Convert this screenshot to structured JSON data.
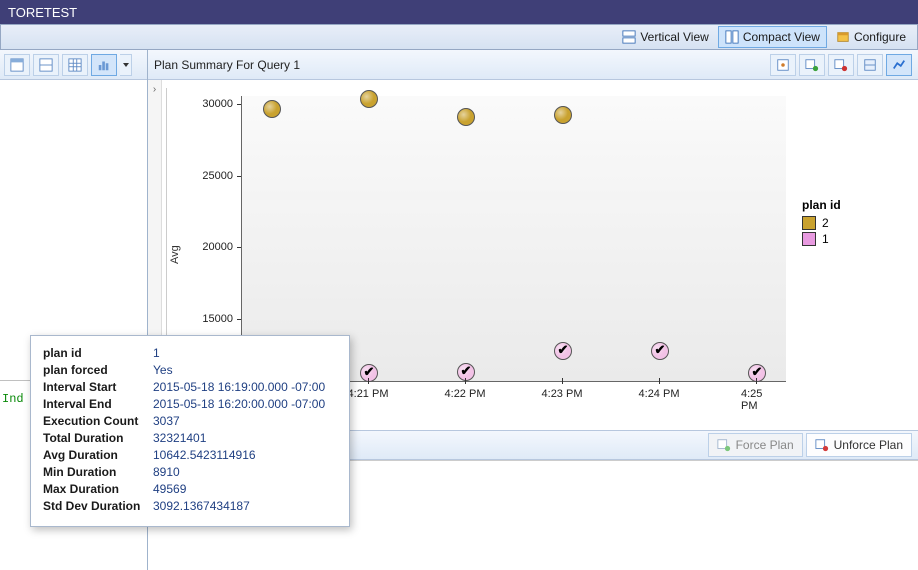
{
  "window_title": "TORETEST",
  "top_toolbar": {
    "vertical_view": "Vertical View",
    "compact_view": "Compact View",
    "configure": "Configure"
  },
  "left_ind_text": "Ind",
  "plan_header_title": "Plan Summary For Query 1",
  "lower_bar": {
    "force_plan": "Force Plan",
    "unforce_plan": "Unforce Plan"
  },
  "legend": {
    "title": "plan id",
    "items": [
      {
        "label": "2",
        "color": "#c9a22f"
      },
      {
        "label": "1",
        "color": "#e89ae0"
      }
    ]
  },
  "ylabel": "Avg",
  "tooltip": [
    {
      "label": "plan id",
      "value": "1"
    },
    {
      "label": "plan forced",
      "value": "Yes"
    },
    {
      "label": "Interval Start",
      "value": "2015-05-18 16:19:00.000 -07:00"
    },
    {
      "label": "Interval End",
      "value": "2015-05-18 16:20:00.000 -07:00"
    },
    {
      "label": "Execution Count",
      "value": "3037"
    },
    {
      "label": "Total Duration",
      "value": "32321401"
    },
    {
      "label": "Avg Duration",
      "value": "10642.5423114916"
    },
    {
      "label": "Min Duration",
      "value": "8910"
    },
    {
      "label": "Max Duration",
      "value": "49569"
    },
    {
      "label": "Std Dev Duration",
      "value": "3092.1367434187"
    }
  ],
  "chart_data": {
    "type": "scatter",
    "title": "Plan Summary For Query 1",
    "xlabel": "",
    "ylabel": "Avg",
    "ylim": [
      10000,
      30000
    ],
    "y_ticks": [
      10000,
      15000,
      20000,
      25000,
      30000
    ],
    "x_categories": [
      "4:20 PM",
      "4:21 PM",
      "4:22 PM",
      "4:23 PM",
      "4:24 PM",
      "4:25 PM"
    ],
    "series": [
      {
        "name": "2",
        "color": "#c9a22f",
        "checked": false,
        "points": [
          {
            "x": "4:20 PM",
            "y": 29100
          },
          {
            "x": "4:21 PM",
            "y": 29800
          },
          {
            "x": "4:22 PM",
            "y": 28500
          },
          {
            "x": "4:23 PM",
            "y": 28700
          }
        ]
      },
      {
        "name": "1",
        "color": "#e89ae0",
        "checked": true,
        "points": [
          {
            "x": "4:20 PM",
            "y": 10600
          },
          {
            "x": "4:21 PM",
            "y": 10600
          },
          {
            "x": "4:22 PM",
            "y": 10700
          },
          {
            "x": "4:23 PM",
            "y": 12200
          },
          {
            "x": "4:24 PM",
            "y": 12200
          },
          {
            "x": "4:25 PM",
            "y": 10600
          }
        ]
      }
    ]
  }
}
